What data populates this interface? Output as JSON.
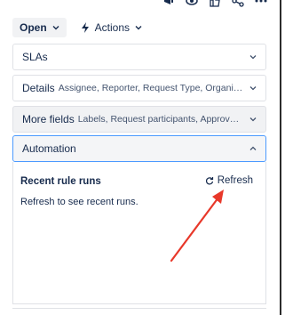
{
  "actions": {
    "open_label": "Open",
    "actions_label": "Actions"
  },
  "panels": {
    "slas": {
      "title": "SLAs"
    },
    "details": {
      "title": "Details",
      "subtitle": "Assignee, Reporter, Request Type, Organizations, Request lan..."
    },
    "more_fields": {
      "title": "More fields",
      "subtitle": "Labels, Request participants, Approvers, Custom Date Ti..."
    },
    "automation": {
      "title": "Automation"
    }
  },
  "automation": {
    "recent_heading": "Recent rule runs",
    "refresh_label": "Refresh",
    "empty_message": "Refresh to see recent runs."
  },
  "colors": {
    "annotation_arrow": "#e8382a",
    "focus_border": "#4c9aff"
  }
}
